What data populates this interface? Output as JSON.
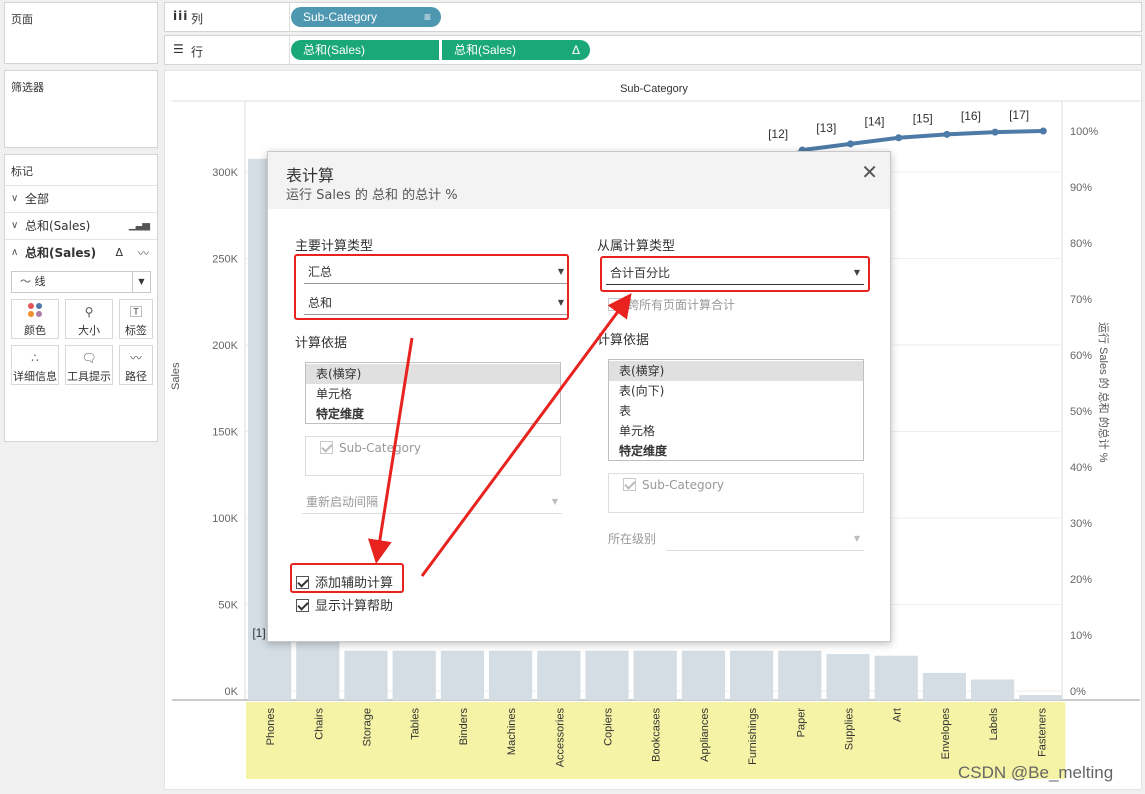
{
  "left_panel": {
    "pages_title": "页面",
    "filters_title": "筛选器",
    "marks_title": "标记",
    "all_label": "全部",
    "sum_sales_1": "总和(Sales)",
    "sum_sales_2": "总和(Sales)",
    "mark_type": "线",
    "buttons": [
      "颜色",
      "大小",
      "标签",
      "详细信息",
      "工具提示",
      "路径"
    ]
  },
  "shelves": {
    "columns_label": "列",
    "rows_label": "行",
    "columns_pill": "Sub-Category",
    "rows_pill_1": "总和(Sales)",
    "rows_pill_2": "总和(Sales)"
  },
  "colors": {
    "pill_blue": "#4e97b1",
    "pill_green": "#1aa878",
    "bar": "#d4dde4",
    "line": "#4d7aa6",
    "highlight": "#f5f3a5",
    "red": "#e8231f"
  },
  "chart_data": {
    "type": "bar",
    "title": "Sub-Category",
    "ylabel": "Sales",
    "y2label": "运行 Sales 的 总和 的总计 %",
    "ylim": [
      0,
      350000
    ],
    "y_ticks": [
      "0K",
      "50K",
      "100K",
      "150K",
      "200K",
      "250K",
      "300K"
    ],
    "y2_ticks": [
      "0%",
      "10%",
      "20%",
      "30%",
      "40%",
      "50%",
      "60%",
      "70%",
      "80%",
      "90%",
      "100%"
    ],
    "categories": [
      "Phones",
      "Chairs",
      "Storage",
      "Tables",
      "Binders",
      "Machines",
      "Accessories",
      "Copiers",
      "Bookcases",
      "Appliances",
      "Furnishings",
      "Paper",
      "Supplies",
      "Art",
      "Envelopes",
      "Labels",
      "Fasteners"
    ],
    "values": [
      330000,
      328000,
      30000,
      30000,
      30000,
      30000,
      30000,
      30000,
      30000,
      30000,
      30000,
      30000,
      28000,
      27000,
      16500,
      12500,
      3000
    ],
    "line_series": {
      "name": "运行 Sales 的 总和 的总计 %",
      "points": [
        {
          "category": "Paper",
          "pct": 96.6
        },
        {
          "category": "Supplies",
          "pct": 97.7
        },
        {
          "category": "Art",
          "pct": 98.8
        },
        {
          "category": "Envelopes",
          "pct": 99.4
        },
        {
          "category": "Labels",
          "pct": 99.8
        },
        {
          "category": "Fasteners",
          "pct": 100
        }
      ],
      "labels": [
        {
          "category": "Phones",
          "text": "[1]"
        },
        {
          "category": "Furnishings",
          "text": "[12]"
        },
        {
          "category": "Paper",
          "text": "[13]"
        },
        {
          "category": "Supplies",
          "text": "[14]"
        },
        {
          "category": "Art",
          "text": "[15]"
        },
        {
          "category": "Envelopes",
          "text": "[16]"
        },
        {
          "category": "Labels",
          "text": "[17]"
        }
      ]
    }
  },
  "dialog": {
    "title": "表计算",
    "subtitle": "运行 Sales 的 总和 的总计 %",
    "primary_type_label": "主要计算类型",
    "primary_type_1": "汇总",
    "primary_type_2": "总和",
    "compute_using_label": "计算依据",
    "left_list": [
      "表(横穿)",
      "单元格",
      "特定维度"
    ],
    "left_dim": "Sub-Category",
    "restart_label": "重新启动间隔",
    "add_secondary": "添加辅助计算",
    "show_help": "显示计算帮助",
    "secondary_type_label": "从属计算类型",
    "secondary_type": "合计百分比",
    "all_pages_cb": "跨所有页面计算合计",
    "right_compute_label": "计算依据",
    "right_list": [
      "表(横穿)",
      "表(向下)",
      "表",
      "单元格",
      "特定维度"
    ],
    "right_dim": "Sub-Category",
    "level_label": "所在级别"
  },
  "watermark": "CSDN @Be_melting"
}
